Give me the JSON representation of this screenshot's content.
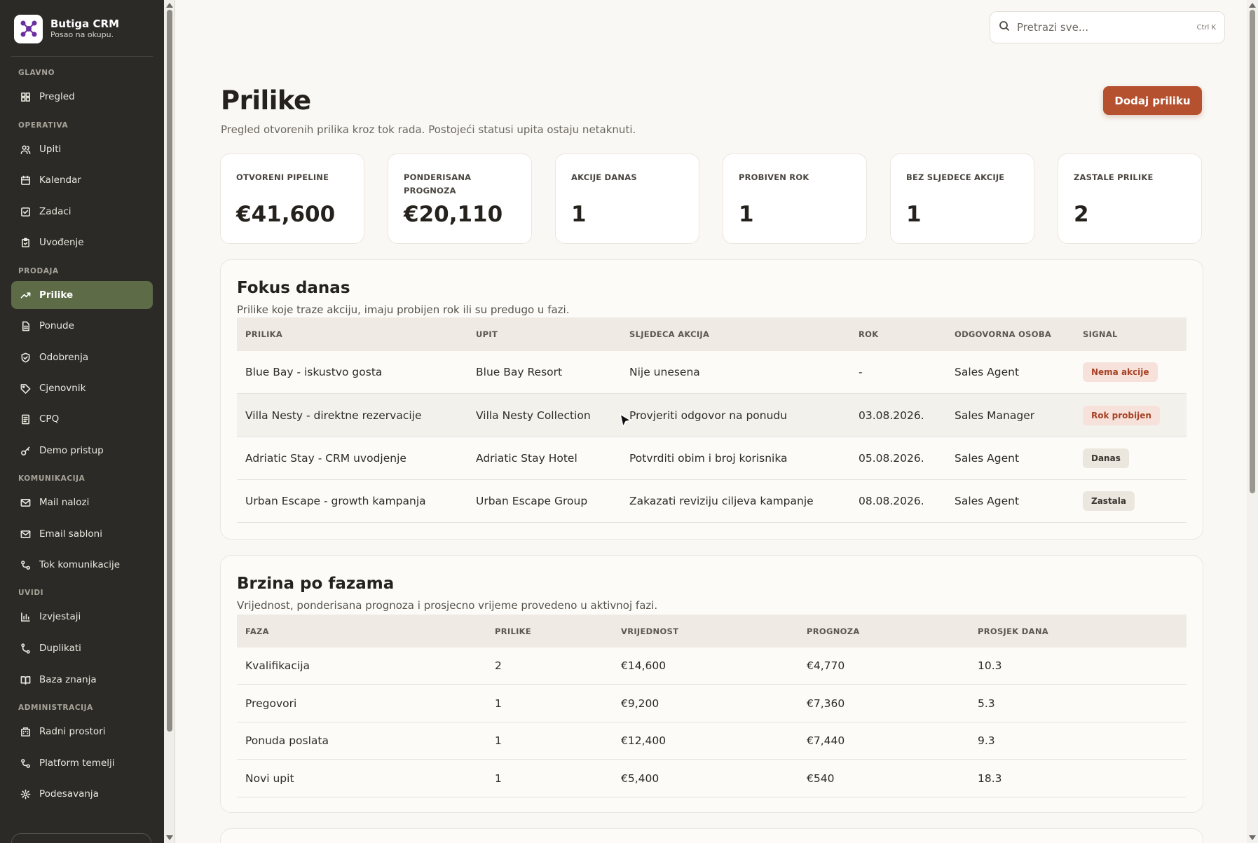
{
  "app": {
    "name": "Butiga CRM",
    "tagline": "Posao na okupu."
  },
  "search": {
    "placeholder": "Pretrazi sve...",
    "shortcut": "Ctrl K"
  },
  "sidebar": {
    "sections": {
      "glavno": "GLAVNO",
      "operativa": "OPERATIVA",
      "prodaja": "PRODAJA",
      "komunikacija": "KOMUNIKACIJA",
      "uvidi": "UVIDI",
      "administracija": "ADMINISTRACIJA"
    },
    "items": {
      "pregled": "Pregled",
      "upiti": "Upiti",
      "kalendar": "Kalendar",
      "zadaci": "Zadaci",
      "uvodjenje": "Uvođenje",
      "prilike": "Prilike",
      "ponude": "Ponude",
      "odobrenja": "Odobrenja",
      "cjenovnik": "Cjenovnik",
      "cpq": "CPQ",
      "demo": "Demo pristup",
      "mail": "Mail nalozi",
      "email_sabloni": "Email sabloni",
      "tok": "Tok komunikacije",
      "izvjestaji": "Izvjestaji",
      "duplikati": "Duplikati",
      "baza": "Baza znanja",
      "radni": "Radni prostori",
      "platform": "Platform temelji",
      "podesavanja": "Podesavanja"
    },
    "active": "prilike",
    "accent_color": "#5d6b46"
  },
  "page": {
    "title": "Prilike",
    "subtitle": "Pregled otvorenih prilika kroz tok rada. Postojeći statusi upita ostaju netaknuti.",
    "add_button": "Dodaj priliku",
    "button_color": "#b5512f"
  },
  "kpis": [
    {
      "label": "OTVORENI PIPELINE",
      "value": "€41,600"
    },
    {
      "label": "PONDERISANA PROGNOZA",
      "value": "€20,110"
    },
    {
      "label": "AKCIJE DANAS",
      "value": "1"
    },
    {
      "label": "PROBIVEN ROK",
      "value": "1"
    },
    {
      "label": "BEZ SLJEDECE AKCIJE",
      "value": "1"
    },
    {
      "label": "ZASTALE PRILIKE",
      "value": "2"
    }
  ],
  "focus": {
    "title": "Fokus danas",
    "subtitle": "Prilike koje traze akciju, imaju probijen rok ili su predugo u fazi.",
    "headers": [
      "PRILIKA",
      "UPIT",
      "SLJEDECA AKCIJA",
      "ROK",
      "ODGOVORNA OSOBA",
      "SIGNAL"
    ],
    "rows": [
      {
        "prilika": "Blue Bay - iskustvo gosta",
        "upit": "Blue Bay Resort",
        "akcija": "Nije unesena",
        "rok": "-",
        "osoba": "Sales Agent",
        "signal": "Nema akcije"
      },
      {
        "prilika": "Villa Nesty - direktne rezervacije",
        "upit": "Villa Nesty Collection",
        "akcija": "Provjeriti odgovor na ponudu",
        "rok": "03.08.2026.",
        "osoba": "Sales Manager",
        "signal": "Rok probijen"
      },
      {
        "prilika": "Adriatic Stay - CRM uvodjenje",
        "upit": "Adriatic Stay Hotel",
        "akcija": "Potvrditi obim i broj korisnika",
        "rok": "05.08.2026.",
        "osoba": "Sales Agent",
        "signal": "Danas"
      },
      {
        "prilika": "Urban Escape - growth kampanja",
        "upit": "Urban Escape Group",
        "akcija": "Zakazati reviziju ciljeva kampanje",
        "rok": "08.08.2026.",
        "osoba": "Sales Agent",
        "signal": "Zastala"
      }
    ]
  },
  "speed": {
    "title": "Brzina po fazama",
    "subtitle": "Vrijednost, ponderisana prognoza i prosjecno vrijeme provedeno u aktivnoj fazi.",
    "headers": [
      "FAZA",
      "PRILIKE",
      "VRIJEDNOST",
      "PROGNOZA",
      "PROSJEK DANA"
    ],
    "rows": [
      {
        "faza": "Kvalifikacija",
        "prilike": "2",
        "vrijednost": "€14,600",
        "prognoza": "€4,770",
        "prosjek": "10.3"
      },
      {
        "faza": "Pregovori",
        "prilike": "1",
        "vrijednost": "€9,200",
        "prognoza": "€7,360",
        "prosjek": "5.3"
      },
      {
        "faza": "Ponuda poslata",
        "prilike": "1",
        "vrijednost": "€12,400",
        "prognoza": "€7,440",
        "prosjek": "9.3"
      },
      {
        "faza": "Novi upit",
        "prilike": "1",
        "vrijednost": "€5,400",
        "prognoza": "€540",
        "prosjek": "18.3"
      }
    ]
  }
}
